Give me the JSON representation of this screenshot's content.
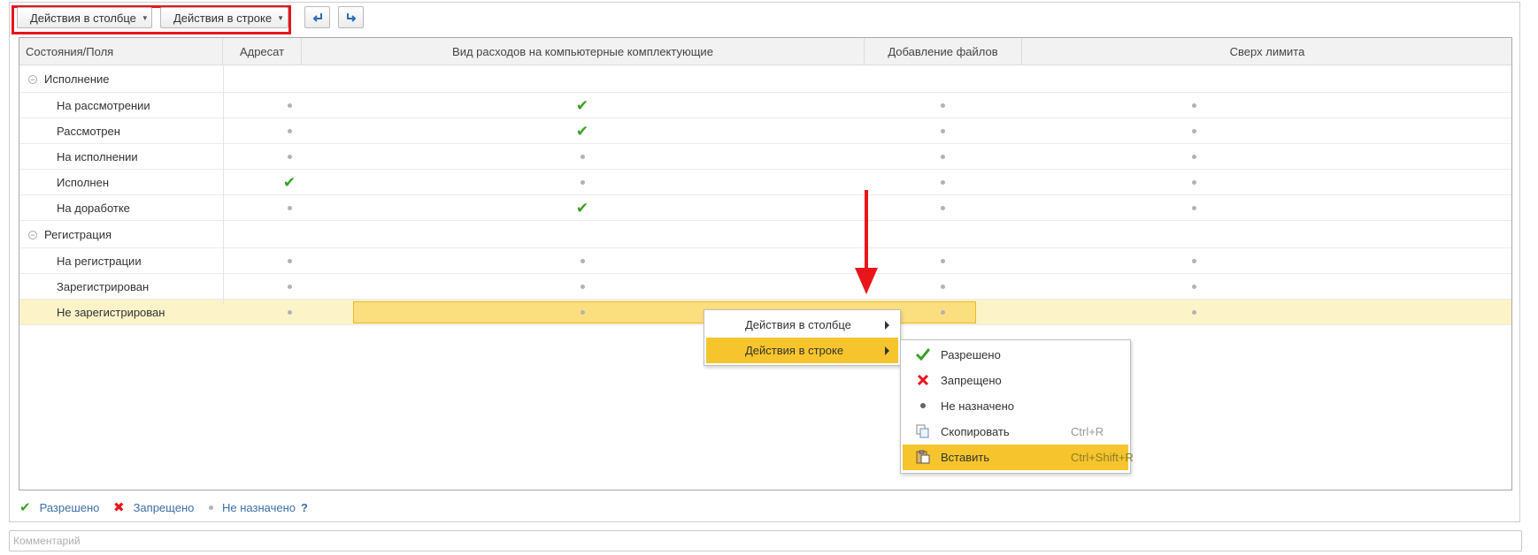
{
  "toolbar": {
    "column_actions_label": "Действия в столбце",
    "row_actions_label": "Действия в строке",
    "undo_icon": "undo-icon",
    "redo_icon": "redo-icon"
  },
  "table": {
    "columns": [
      "Состояния/Поля",
      "Адресат",
      "Вид расходов на компьютерные комплектующие",
      "Добавление файлов",
      "Сверх лимита"
    ],
    "groups": [
      {
        "label": "Исполнение",
        "rows": [
          {
            "label": "На рассмотрении",
            "values": [
              "dot",
              "check",
              "dot",
              "dot"
            ]
          },
          {
            "label": "Рассмотрен",
            "values": [
              "dot",
              "check",
              "dot",
              "dot"
            ]
          },
          {
            "label": "На исполнении",
            "values": [
              "dot",
              "dot",
              "dot",
              "dot"
            ]
          },
          {
            "label": "Исполнен",
            "values": [
              "check",
              "dot",
              "dot",
              "dot"
            ]
          },
          {
            "label": "На доработке",
            "values": [
              "dot",
              "check",
              "dot",
              "dot"
            ]
          }
        ]
      },
      {
        "label": "Регистрация",
        "rows": [
          {
            "label": "На регистрации",
            "values": [
              "dot",
              "dot",
              "dot",
              "dot"
            ]
          },
          {
            "label": "Зарегистрирован",
            "values": [
              "dot",
              "dot",
              "dot",
              "dot"
            ]
          },
          {
            "label": "Не зарегистрирован",
            "values": [
              "dot",
              "dot",
              "dot",
              "dot"
            ],
            "selected": true
          }
        ]
      }
    ]
  },
  "context_menu": {
    "items": [
      {
        "label": "Действия в столбце",
        "has_submenu": true,
        "active": false
      },
      {
        "label": "Действия в строке",
        "has_submenu": true,
        "active": true
      }
    ]
  },
  "submenu": {
    "items": [
      {
        "label": "Разрешено",
        "icon": "check-icon",
        "shortcut": ""
      },
      {
        "label": "Запрещено",
        "icon": "cross-icon",
        "shortcut": ""
      },
      {
        "label": "Не назначено",
        "icon": "dot-icon",
        "shortcut": ""
      },
      {
        "label": "Скопировать",
        "icon": "copy-icon",
        "shortcut": "Ctrl+R"
      },
      {
        "label": "Вставить",
        "icon": "paste-icon",
        "shortcut": "Ctrl+Shift+R",
        "active": true
      }
    ]
  },
  "legend": {
    "allowed": "Разрешено",
    "forbidden": "Запрещено",
    "unassigned": "Не назначено",
    "help": "?"
  },
  "comment": {
    "placeholder": "Комментарий",
    "value": ""
  },
  "colors": {
    "check": "#3aa126",
    "cross": "#e8151b",
    "selection": "#fbdf7e",
    "menu_active": "#f6c52d",
    "annotation": "#e8151b",
    "link": "#3d6fa8"
  }
}
